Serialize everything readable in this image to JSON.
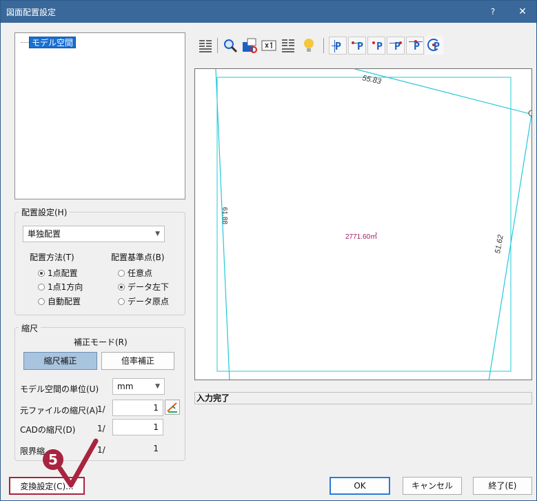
{
  "window": {
    "title": "図面配置設定",
    "help_label": "?",
    "close_label": "✕"
  },
  "tree": {
    "items": [
      {
        "label": "モデル空間",
        "selected": true
      }
    ]
  },
  "placement": {
    "group_label": "配置設定(H)",
    "mode_select": "単独配置",
    "method_label": "配置方法(T)",
    "method_options": [
      {
        "label": "1点配置",
        "checked": true
      },
      {
        "label": "1点1方向",
        "checked": false
      },
      {
        "label": "自動配置",
        "checked": false
      }
    ],
    "base_label": "配置基準点(B)",
    "base_options": [
      {
        "label": "任意点",
        "checked": false
      },
      {
        "label": "データ左下",
        "checked": true
      },
      {
        "label": "データ原点",
        "checked": false
      }
    ]
  },
  "scale": {
    "group_label": "縮尺",
    "mode_label": "補正モード(R)",
    "btn_scale_correct": "縮尺補正",
    "btn_ratio_correct": "倍率補正",
    "unit_label": "モデル空間の単位(U)",
    "unit_value": "mm",
    "source_label": "元ファイルの縮尺(A)",
    "source_prefix": "1/",
    "source_value": "1",
    "cad_label": "CADの縮尺(D)",
    "cad_prefix": "1/",
    "cad_value": "1",
    "limit_label": "限界縮",
    "limit_prefix": "1/",
    "limit_value": "1"
  },
  "preview": {
    "labels": {
      "top_edge": "55.83",
      "left_edge": "61.88",
      "right_edge": "51.62",
      "area": "2771.60㎡"
    },
    "line_color": "#22c8d8"
  },
  "toolbar": {
    "icons": [
      "read-icon",
      "zoom-icon",
      "fit-icon",
      "scale-x1-icon",
      "create-icon",
      "light-bulb-icon",
      "point-left-icon",
      "point-top-left-icon",
      "point-mid-icon",
      "point-right-icon",
      "point-top-icon",
      "point-rotate-icon"
    ]
  },
  "status": {
    "text": "入力完了"
  },
  "buttons": {
    "convert": "変換設定(C)...",
    "ok": "OK",
    "cancel": "キャンセル",
    "exit": "終了(E)"
  },
  "annotation": {
    "step": "5",
    "color": "#a8243f"
  }
}
